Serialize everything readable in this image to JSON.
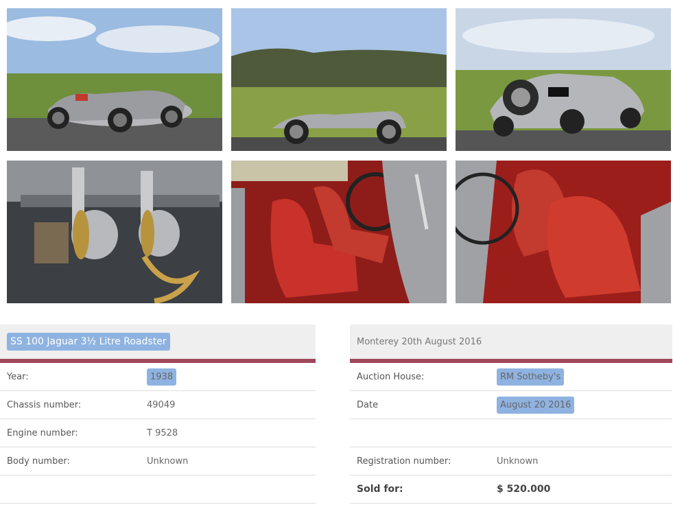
{
  "photos": [
    {
      "name": "photo-front-three-quarter",
      "alt": "Silver roadster front three-quarter view"
    },
    {
      "name": "photo-side-profile",
      "alt": "Silver roadster side profile"
    },
    {
      "name": "photo-rear-three-quarter",
      "alt": "Silver roadster rear three-quarter view"
    },
    {
      "name": "photo-engine-bay",
      "alt": "Engine with SS carburettors"
    },
    {
      "name": "photo-interior-seats",
      "alt": "Red leather seats and steering wheel"
    },
    {
      "name": "photo-interior-red-seats",
      "alt": "Red leather seats"
    }
  ],
  "car_panel": {
    "title": "SS 100 Jaguar 3½ Litre Roadster",
    "rows": [
      {
        "label": "Year:",
        "value": "1938"
      },
      {
        "label": "Chassis number:",
        "value": "49049"
      },
      {
        "label": "Engine number:",
        "value": "T 9528"
      },
      {
        "label": "Body number:",
        "value": "Unknown"
      },
      {
        "label": "",
        "value": ""
      }
    ]
  },
  "auction_panel": {
    "title": "Monterey 20th August 2016",
    "rows": [
      {
        "label": "Auction House:",
        "value": "RM Sotheby's"
      },
      {
        "label": "Date",
        "value": "August 20 2016"
      },
      {
        "label": "",
        "value": ""
      },
      {
        "label": "Registration number:",
        "value": "Unknown"
      },
      {
        "label": "Sold for:",
        "value": "$ 520.000"
      }
    ]
  },
  "colors": {
    "accent_bar": "#a0475b",
    "pill": "#8fb3e1",
    "header_bg": "#efefef"
  }
}
